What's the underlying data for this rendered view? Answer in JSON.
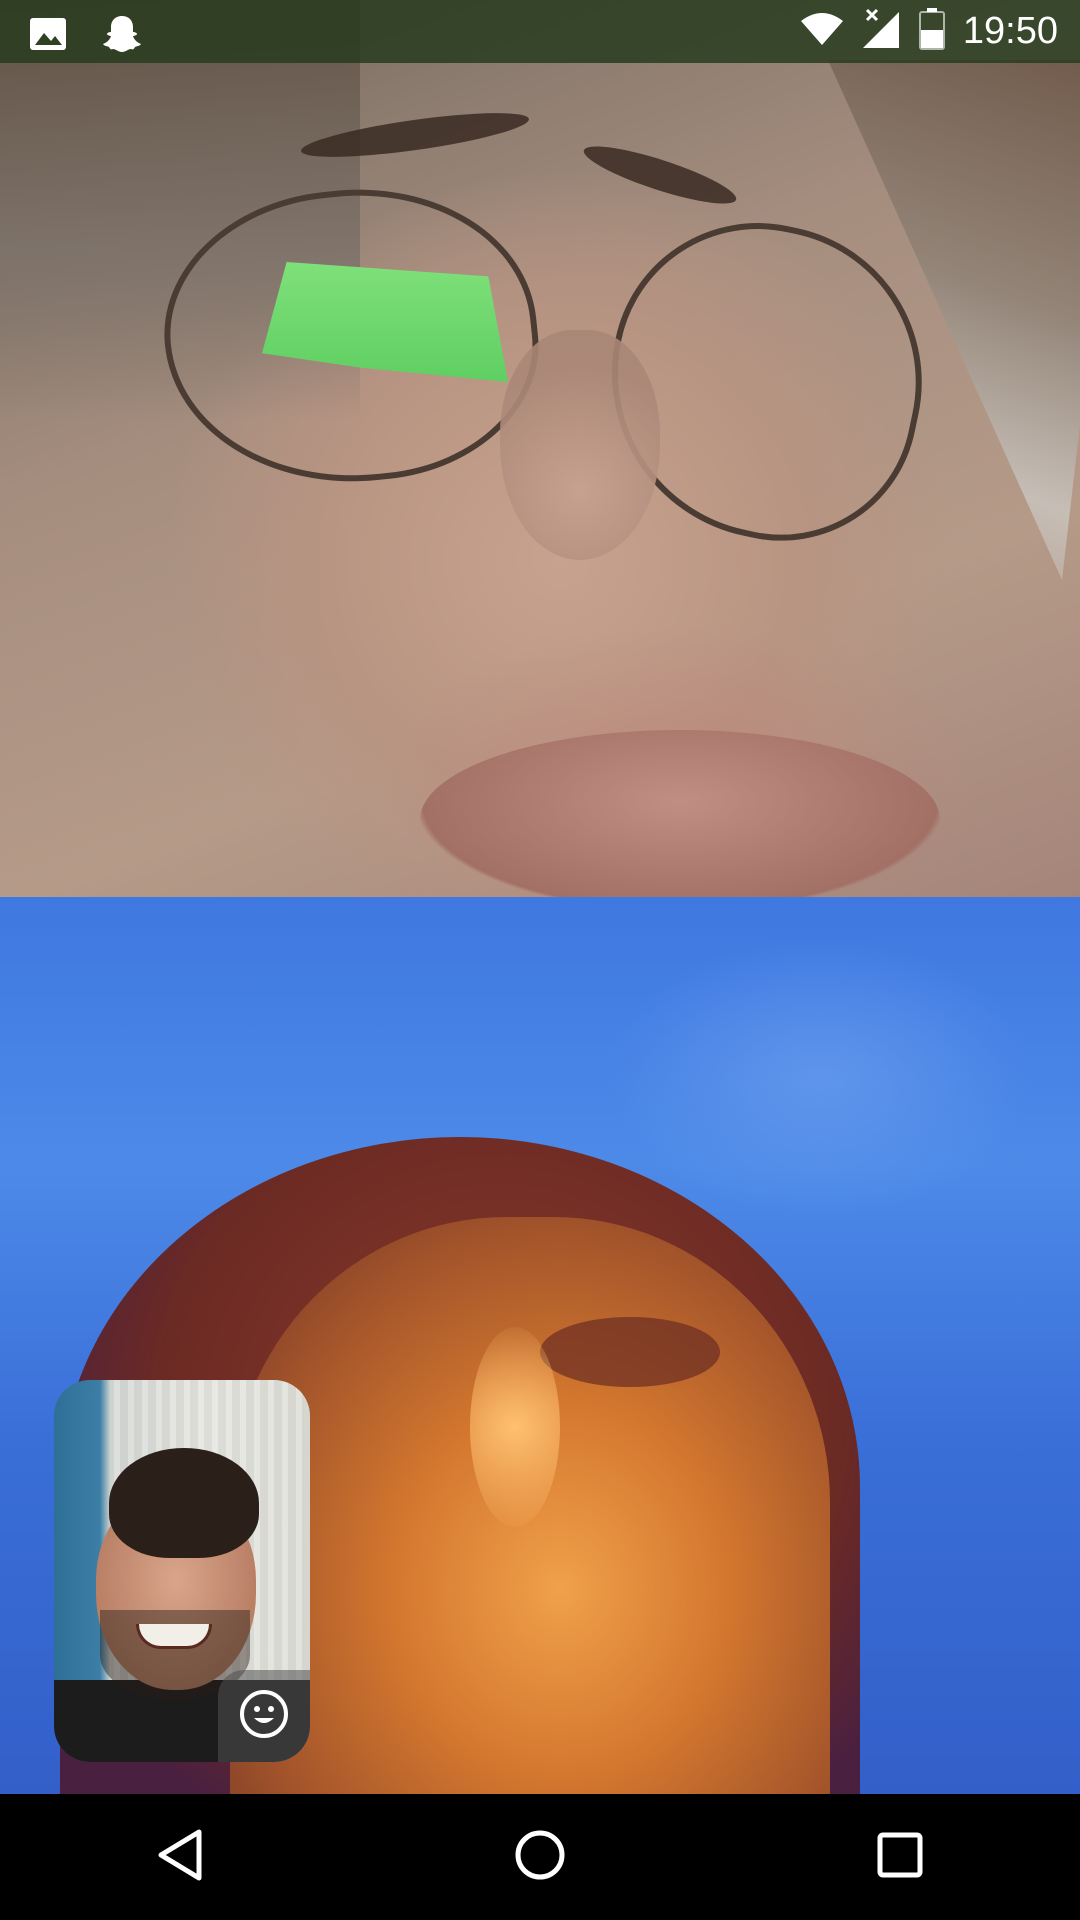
{
  "status_bar": {
    "time": "19:50",
    "icons": [
      "gallery-icon",
      "snapchat-ghost-icon",
      "wifi-icon",
      "signal-no-data-icon",
      "battery-icon"
    ]
  },
  "call": {
    "remote_participants": [
      "remote-video-top",
      "remote-video-bottom"
    ],
    "self_preview": "self-camera-preview",
    "controls": [
      "emoji-lens-icon"
    ]
  },
  "navigation_bar": {
    "buttons": [
      "back-icon",
      "home-icon",
      "recents-icon"
    ]
  },
  "colors": {
    "status_bar_bg": "#283c1e",
    "nav_bar_bg": "#000000",
    "icon_white": "#ffffff"
  }
}
